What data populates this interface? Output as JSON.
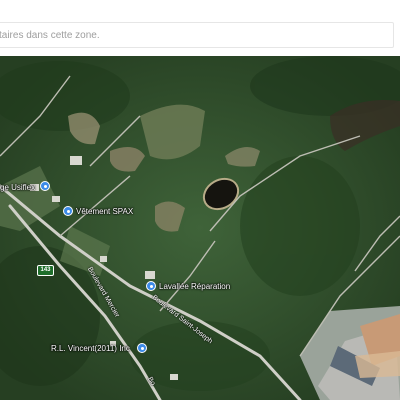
{
  "comment_input": {
    "placeholder": "taires dans cette zone."
  },
  "map": {
    "route_number": "143",
    "places": [
      {
        "name": "ge Usiflex",
        "icon": "shopping-pin-icon"
      },
      {
        "name": "Vêtement SPAX",
        "icon": "shopping-pin-icon"
      },
      {
        "name": "Lavallée Réparation",
        "icon": "pin-icon"
      },
      {
        "name": "R.L. Vincent(2011) Inc",
        "icon": "pin-icon"
      }
    ],
    "roads": [
      {
        "name": "Boulevard Saint-Joseph"
      },
      {
        "name": "Boulevard Mercier"
      },
      {
        "name": "Bo"
      }
    ]
  }
}
